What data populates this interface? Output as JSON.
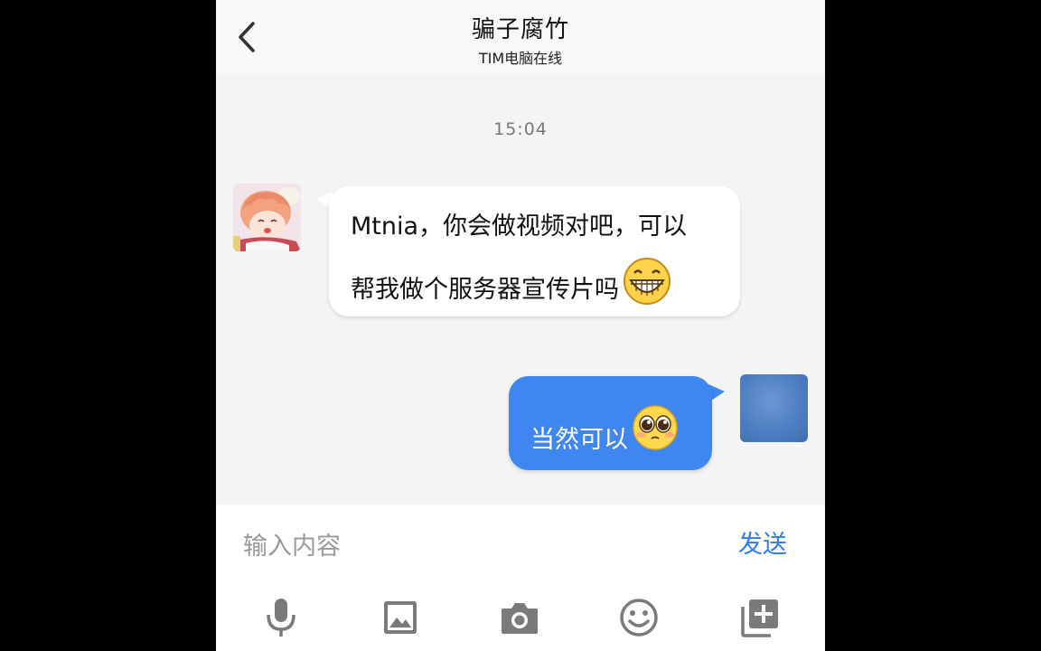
{
  "header": {
    "back_icon": "chevron-left-icon",
    "title": "骗子腐竹",
    "subtitle": "TIM电脑在线"
  },
  "chat": {
    "timestamp": "15:04",
    "messages": [
      {
        "side": "left",
        "line1": "Mtnia，你会做视频对吧，可以",
        "line2": "帮我做个服务器宣传片吗",
        "emoji": "grinning-face-icon"
      },
      {
        "side": "right",
        "line1": "当然可以",
        "emoji": "pleading-face-icon"
      }
    ]
  },
  "input": {
    "placeholder": "输入内容",
    "value": "",
    "send_label": "发送"
  },
  "toolbar": {
    "icons": [
      "microphone-icon",
      "image-icon",
      "camera-icon",
      "smiley-icon",
      "add-more-icon"
    ]
  },
  "colors": {
    "accent": "#2d7cf6",
    "bubble_right": "#3f86f0",
    "bubble_left": "#ffffff",
    "background": "#f3f4f6"
  }
}
